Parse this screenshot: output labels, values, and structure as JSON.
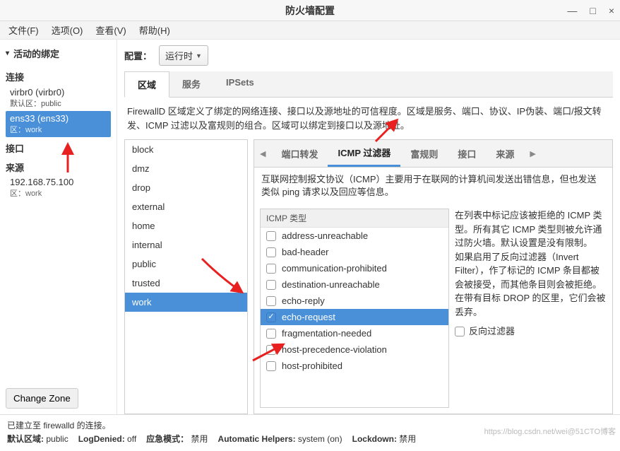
{
  "window": {
    "title": "防火墙配置"
  },
  "menubar": {
    "file": "文件(F)",
    "options": "选项(O)",
    "view": "查看(V)",
    "help": "帮助(H)"
  },
  "sidebar": {
    "header": "活动的绑定",
    "groups": {
      "connections": "连接",
      "interfaces": "接口",
      "sources": "来源"
    },
    "conn": [
      {
        "name": "virbr0 (virbr0)",
        "sub": "默认区：public"
      },
      {
        "name": "ens33 (ens33)",
        "sub": "区：work"
      }
    ],
    "source": {
      "ip": "192.168.75.100",
      "sub": "区：work"
    },
    "change_zone": "Change Zone"
  },
  "config": {
    "label": "配置：",
    "value": "运行时"
  },
  "tabs": {
    "zones": "区域",
    "services": "服务",
    "ipsets": "IPSets"
  },
  "zones_desc": "FirewallD 区域定义了绑定的网络连接、接口以及源地址的可信程度。区域是服务、端口、协议、IP伪装、端口/报文转发、ICMP 过滤以及富规则的组合。区域可以绑定到接口以及源地址。",
  "zone_list": [
    "block",
    "dmz",
    "drop",
    "external",
    "home",
    "internal",
    "public",
    "trusted",
    "work"
  ],
  "subtabs": {
    "portfwd": "端口转发",
    "icmp": "ICMP 过滤器",
    "rich": "富规则",
    "iface": "接口",
    "source": "来源"
  },
  "icmp_panel": {
    "desc": "互联网控制报文协议（ICMP）主要用于在联网的计算机间发送出错信息，但也发送类似 ping 请求以及回应等信息。",
    "header": "ICMP 类型",
    "types": [
      "address-unreachable",
      "bad-header",
      "communication-prohibited",
      "destination-unreachable",
      "echo-reply",
      "echo-request",
      "fragmentation-needed",
      "host-precedence-violation",
      "host-prohibited"
    ],
    "help": "在列表中标记应该被拒绝的 ICMP 类型。所有其它 ICMP 类型则被允许通过防火墙。默认设置是没有限制。\n如果启用了反向过滤器（Invert Filter），作了标记的 ICMP 条目都被会被接受，而其他条目则会被拒绝。在带有目标 DROP 的区里，它们会被丢弃。",
    "invert_label": "反向过滤器"
  },
  "status": {
    "line1": "已建立至 firewalld 的连接。",
    "default_zone_label": "默认区域:",
    "default_zone": "public",
    "logdenied_label": "LogDenied:",
    "logdenied": "off",
    "panic_label": "应急模式：",
    "panic": "禁用",
    "autohelpers_label": "Automatic Helpers:",
    "autohelpers": "system (on)",
    "lockdown_label": "Lockdown:",
    "lockdown": "禁用"
  },
  "watermark": "https://blog.csdn.net/wei@51CTO博客"
}
